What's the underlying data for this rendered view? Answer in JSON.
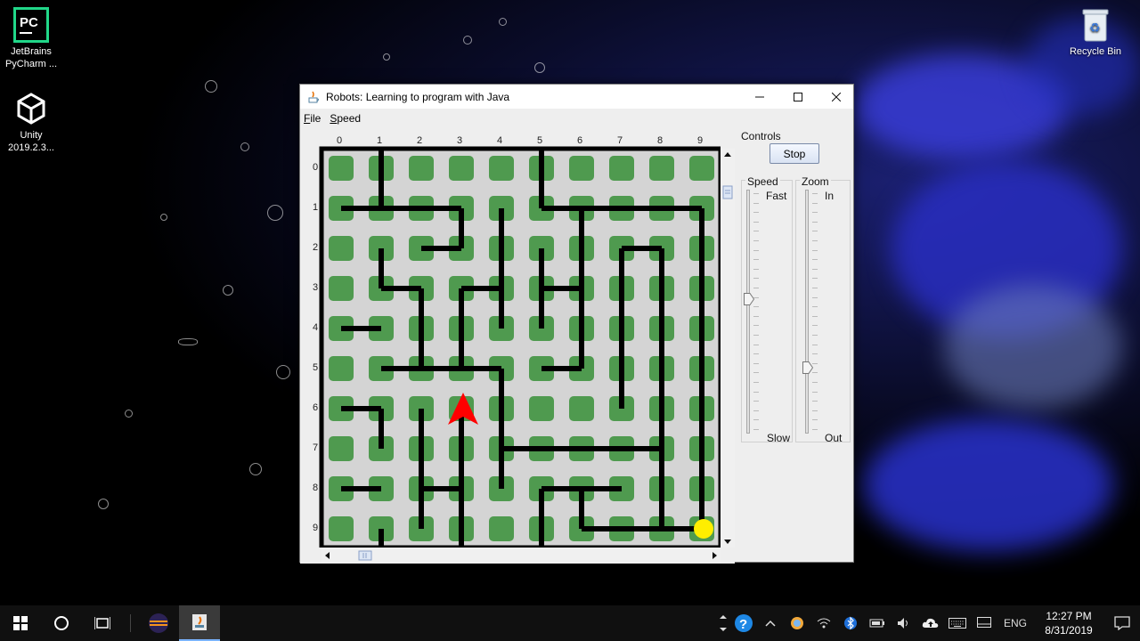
{
  "desktop": {
    "icons": [
      {
        "label_line1": "JetBrains",
        "label_line2": "PyCharm ..."
      },
      {
        "label_line1": "Unity",
        "label_line2": "2019.2.3..."
      },
      {
        "label_line1": "Recycle Bin",
        "label_line2": ""
      }
    ]
  },
  "window": {
    "title": "Robots: Learning to program with Java",
    "menu": [
      "File",
      "Speed"
    ]
  },
  "maze": {
    "columns": [
      "0",
      "1",
      "2",
      "3",
      "4",
      "5",
      "6",
      "7",
      "8",
      "9"
    ],
    "rows": [
      "0",
      "1",
      "2",
      "3",
      "4",
      "5",
      "6",
      "7",
      "8",
      "9"
    ],
    "robot": {
      "col": 3,
      "row": 6,
      "facing": "north",
      "color": "#ff0000"
    },
    "goal": {
      "col": 9,
      "row": 9,
      "color": "#ffee00"
    },
    "cell_color": "#4f9a4f",
    "floor_color": "#d4d4d4",
    "wall_color": "#000000"
  },
  "controls": {
    "group_label": "Controls",
    "stop_label": "Stop",
    "speed": {
      "label": "Speed",
      "max_label": "Fast",
      "min_label": "Slow",
      "level": 0.55
    },
    "zoom": {
      "label": "Zoom",
      "max_label": "In",
      "min_label": "Out",
      "level": 0.27
    }
  },
  "taskbar": {
    "language": "ENG",
    "time": "12:27 PM",
    "date": "8/31/2019"
  }
}
